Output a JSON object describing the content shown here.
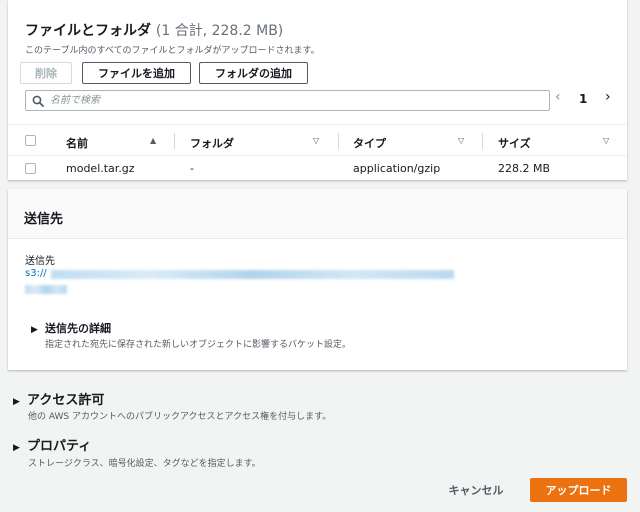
{
  "files": {
    "title": "ファイルとフォルダ",
    "count": "(1 合計, 228.2 MB)",
    "description": "このテーブル内のすべてのファイルとフォルダがアップロードされます。",
    "delete_label": "削除",
    "add_files_label": "ファイルを追加",
    "add_folder_label": "フォルダの追加",
    "search_placeholder": "名前で検索",
    "pager": {
      "prev": "‹",
      "page": "1",
      "next": "›"
    },
    "columns": [
      {
        "label": "名前",
        "sort": "▲"
      },
      {
        "label": "フォルダ",
        "sort": "▽"
      },
      {
        "label": "タイプ",
        "sort": "▽"
      },
      {
        "label": "サイズ",
        "sort": "▽"
      }
    ],
    "rows": [
      {
        "name": "model.tar.gz",
        "folder": "-",
        "type": "application/gzip",
        "size": "228.2 MB"
      }
    ]
  },
  "destination": {
    "title": "送信先",
    "label": "送信先",
    "url_prefix": "s3://",
    "details_label": "送信先の詳細",
    "details_desc": "指定された宛先に保存された新しいオブジェクトに影響するバケット設定。"
  },
  "access": {
    "title": "アクセス許可",
    "desc": "他の AWS アカウントへのパブリックアクセスとアクセス権を付与します。"
  },
  "properties": {
    "title": "プロパティ",
    "desc": "ストレージクラス、暗号化設定、タグなどを指定します。"
  },
  "footer": {
    "cancel_label": "キャンセル",
    "upload_label": "アップロード"
  },
  "colors": {
    "accent": "#ec7211",
    "link": "#0073bb"
  }
}
